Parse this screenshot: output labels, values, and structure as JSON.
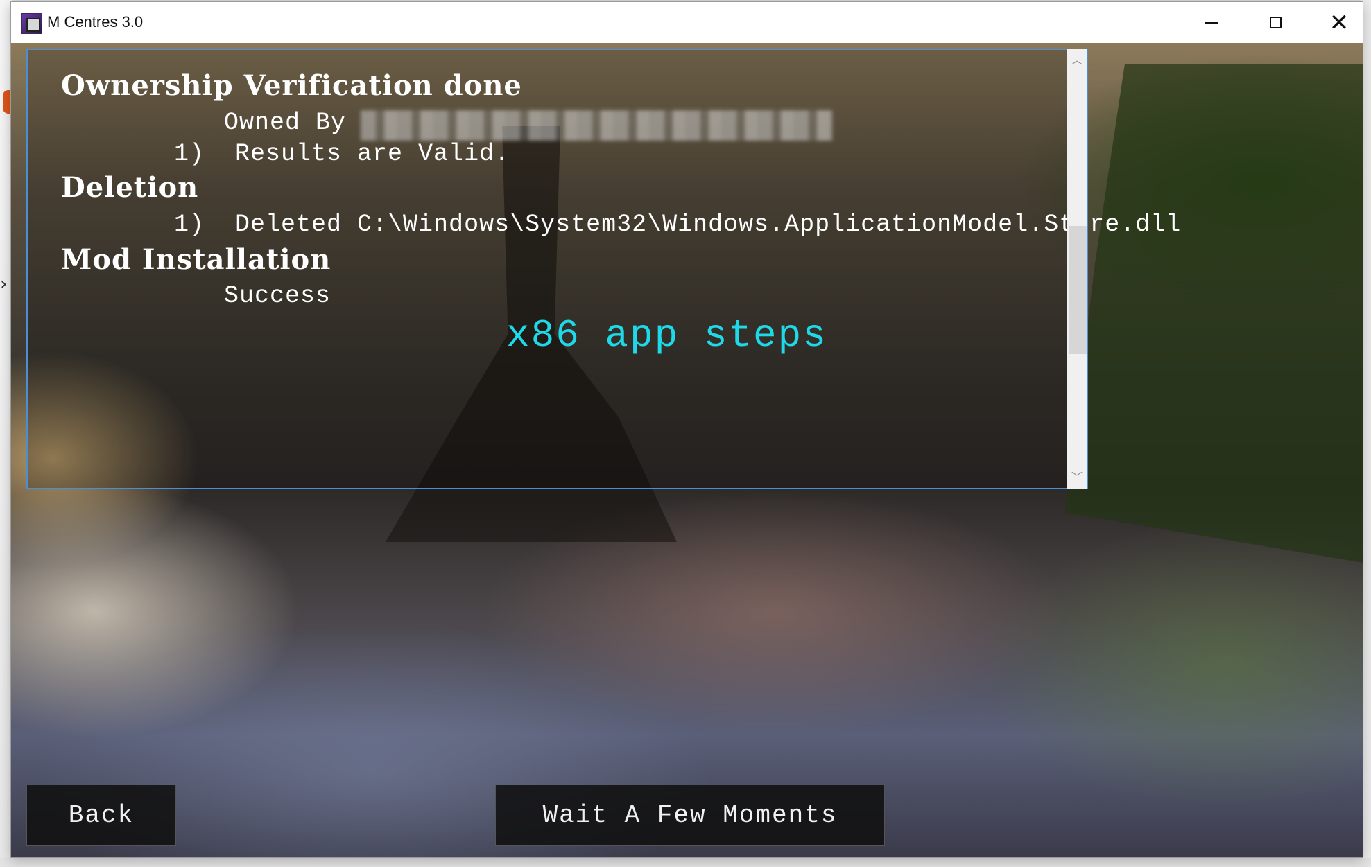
{
  "window": {
    "title": "M Centres 3.0",
    "controls": {
      "minimize": "—",
      "maximize": "☐",
      "close": "✕"
    }
  },
  "log": {
    "ownership_heading": "Ownership Verification done",
    "owned_by_label": "Owned By",
    "ownership_result": "1)  Results are Valid.",
    "deletion_heading": "Deletion",
    "deletion_result": "1)  Deleted C:\\Windows\\System32\\Windows.ApplicationModel.Store.dll",
    "mod_heading": "Mod Installation",
    "mod_result": "Success",
    "status": "x86 app steps"
  },
  "buttons": {
    "back": "Back",
    "wait": "Wait A Few Moments"
  },
  "colors": {
    "status_text": "#1fd8e8",
    "panel_border": "#4a8fd6",
    "button_bg": "#101010"
  },
  "icons": {
    "app": "app-icon",
    "scroll_up": "chevron-up-icon",
    "scroll_down": "chevron-down-icon"
  }
}
